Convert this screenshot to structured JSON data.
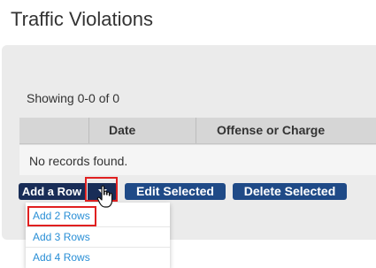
{
  "page": {
    "title": "Traffic Violations",
    "showing": "Showing 0-0 of 0"
  },
  "table": {
    "columns": [
      "",
      "Date",
      "Offense or Charge"
    ],
    "empty_message": "No records found."
  },
  "toolbar": {
    "add_row_label": "Add a Row",
    "edit_selected_label": "Edit Selected",
    "delete_selected_label": "Delete Selected"
  },
  "add_row_menu": {
    "items": [
      "Add 2 Rows",
      "Add 3 Rows",
      "Add 4 Rows"
    ]
  },
  "icons": {
    "dropdown_caret": "caret-down-icon",
    "cursor": "hand-pointer-icon"
  },
  "colors": {
    "primary_button": "#1f4a87",
    "dark_button": "#192d57",
    "link": "#2a8fd6",
    "highlight": "#e02020"
  }
}
